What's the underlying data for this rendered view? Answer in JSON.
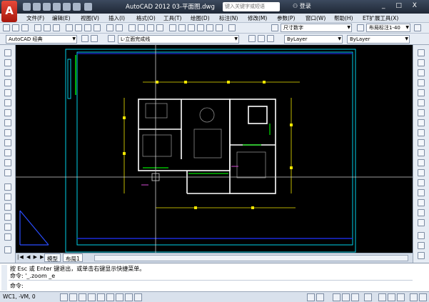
{
  "app": {
    "logo_letter": "A",
    "title": "AutoCAD 2012  03-平面图.dwg",
    "search_placeholder": "键入关键字或短语",
    "login_label": "登录",
    "window_controls": "_ □ X"
  },
  "menu": [
    "文件(F)",
    "编辑(E)",
    "视图(V)",
    "插入(I)",
    "格式(O)",
    "工具(T)",
    "绘图(D)",
    "标注(N)",
    "修改(M)",
    "参数(P)",
    "窗口(W)",
    "帮助(H)",
    "ET扩展工具(X)"
  ],
  "toolbar1": {
    "dimstyle": "尺寸数字",
    "dimscale": "布局标注1-40"
  },
  "toolbar2": {
    "workspace": "AutoCAD 经典",
    "layer": "L-立面完成线",
    "color": "ByLayer",
    "linetype": "ByLayer"
  },
  "tabs": {
    "model": "模型",
    "layout": "布局1"
  },
  "command": {
    "line1": "按 Esc 或 Enter 键退出，或单击右键显示快捷菜单。",
    "line2": "命令: '_.zoom _e",
    "line3": "命令:"
  },
  "status": {
    "coords": "WC1, -VM, 0"
  },
  "colors": {
    "canvas": "#000000",
    "frame_cyan": "#00d0e8",
    "blue_line": "#1c2bd8",
    "wall": "#ffffff",
    "dim_yellow": "#f2e600",
    "green": "#00e000",
    "accent_red": "#c22a1c"
  }
}
